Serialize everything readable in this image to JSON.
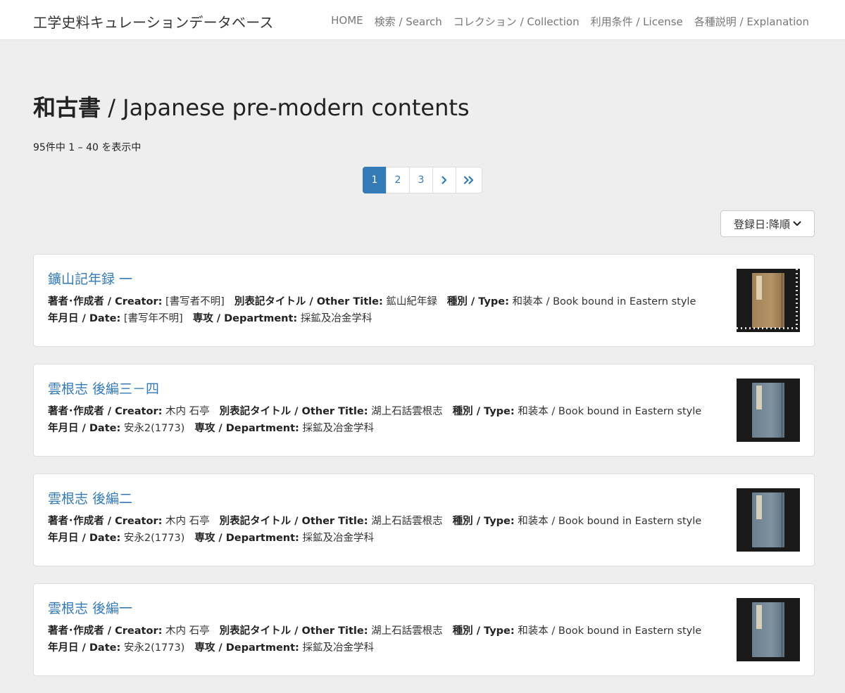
{
  "site": {
    "title": "工学史料キュレーションデータベース"
  },
  "nav": {
    "items": [
      {
        "label": "HOME"
      },
      {
        "label": "検索 / Search"
      },
      {
        "label": "コレクション / Collection"
      },
      {
        "label": "利用条件 / License"
      },
      {
        "label": "各種説明 / Explanation"
      }
    ]
  },
  "page": {
    "title_jp": "和古書",
    "title_en": " / Japanese pre-modern contents",
    "result_count": "95件中 1 – 40 を表示中"
  },
  "pagination": {
    "pages": [
      "1",
      "2",
      "3"
    ],
    "current": "1",
    "next_icon": "chevron-right-icon",
    "last_icon": "double-chevron-right-icon"
  },
  "sort": {
    "selected": "登録日:降順",
    "icon": "chevron-down-icon"
  },
  "labels": {
    "creator": "著者･作成者 / Creator:",
    "other_title": "別表記タイトル / Other Title:",
    "type": "種別 / Type:",
    "date": "年月日 / Date:",
    "department": "専攻 / Department:"
  },
  "items": [
    {
      "title": "鑛山記年録 一",
      "creator": "[書写者不明]",
      "other_title": "鉱山紀年録",
      "type": "和装本 / Book bound in Eastern style",
      "date": "[書写年不明]",
      "department": "採鉱及冶金学科",
      "thumb_color": "#a0825a"
    },
    {
      "title": "雲根志 後編三－四",
      "creator": "木内 石亭",
      "other_title": "湖上石話雲根志",
      "type": "和装本 / Book bound in Eastern style",
      "date": "安永2(1773)",
      "department": "採鉱及冶金学科",
      "thumb_color": "#6c7f8e"
    },
    {
      "title": "雲根志 後編二",
      "creator": "木内 石亭",
      "other_title": "湖上石話雲根志",
      "type": "和装本 / Book bound in Eastern style",
      "date": "安永2(1773)",
      "department": "採鉱及冶金学科",
      "thumb_color": "#6c7f8e"
    },
    {
      "title": "雲根志 後編一",
      "creator": "木内 石亭",
      "other_title": "湖上石話雲根志",
      "type": "和装本 / Book bound in Eastern style",
      "date": "安永2(1773)",
      "department": "採鉱及冶金学科",
      "thumb_color": "#6c7f8e"
    }
  ]
}
